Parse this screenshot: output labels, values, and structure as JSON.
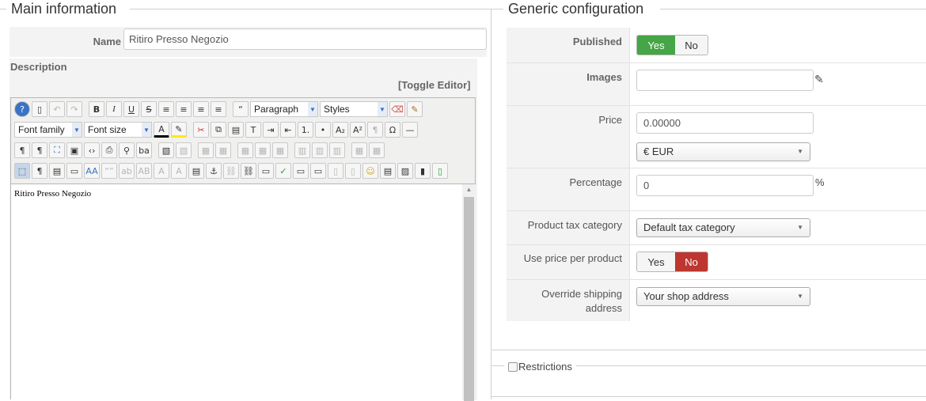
{
  "main": {
    "legend": "Main information",
    "name_label": "Name",
    "name_value": "Ritiro Presso Negozio",
    "description_label": "Description",
    "toggle_editor": "[Toggle Editor]",
    "editor": {
      "format_select": "Paragraph",
      "styles_select": "Styles",
      "font_family_select": "Font family",
      "font_size_select": "Font size",
      "content": "Ritiro Presso Negozio"
    }
  },
  "generic": {
    "legend": "Generic configuration",
    "published": {
      "label": "Published",
      "yes": "Yes",
      "no": "No",
      "selected": "Yes"
    },
    "images": {
      "label": "Images",
      "value": ""
    },
    "price": {
      "label": "Price",
      "value": "0.00000",
      "currency": "€ EUR"
    },
    "percentage": {
      "label": "Percentage",
      "value": "0",
      "unit": "%"
    },
    "tax_category": {
      "label": "Product tax category",
      "value": "Default tax category"
    },
    "use_price_per_product": {
      "label": "Use price per product",
      "yes": "Yes",
      "no": "No",
      "selected": "No"
    },
    "override_shipping": {
      "label_line1": "Override shipping",
      "label_line2": "address",
      "value": "Your shop address"
    }
  },
  "restrictions": {
    "label": "Restrictions"
  },
  "colors": {
    "green": "#46a546",
    "red": "#bd362f",
    "label_bg": "#f3f3f3"
  }
}
